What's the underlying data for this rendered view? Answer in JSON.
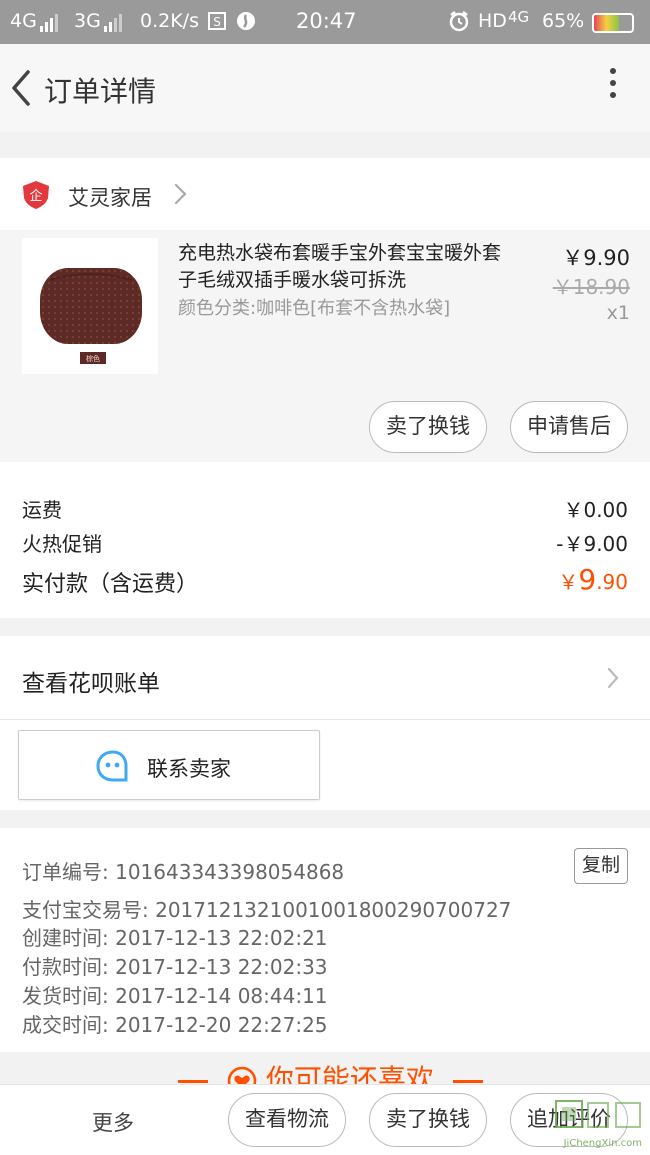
{
  "status_bar": {
    "net1": "4G",
    "net2": "3G",
    "speed": "0.2K/s",
    "time": "20:47",
    "hd": "HD",
    "net3": "4G",
    "battery": "65%",
    "battery_level": 0.65
  },
  "header": {
    "title": "订单详情"
  },
  "shop": {
    "name": "艾灵家居",
    "logo_glyph": "企"
  },
  "item": {
    "title": "充电热水袋布套暖手宝外套宝宝暖外套子毛绒双插手暖水袋可拆洗",
    "sku": "颜色分类:咖啡色[布套不含热水袋]",
    "price": "￥9.90",
    "original_price": "￥18.90",
    "quantity": "x1",
    "thumb_tag": "棕色",
    "buttons": [
      "卖了换钱",
      "申请售后"
    ]
  },
  "fees": {
    "shipping_label": "运费",
    "shipping_value": "￥0.00",
    "promo_label": "火热促销",
    "promo_value": "-￥9.00",
    "paid_label": "实付款（含运费）",
    "paid_currency": "￥",
    "paid_int": "9",
    "paid_dec": ".90"
  },
  "huabei": {
    "label": "查看花呗账单"
  },
  "contact": {
    "label": "联系卖家"
  },
  "order_info": {
    "copy_label": "复制",
    "rows": [
      {
        "label": "订单编号:",
        "value": "101643343398054868"
      },
      {
        "label": "支付宝交易号:",
        "value": "2017121321001001800290700727"
      },
      {
        "label": "创建时间:",
        "value": "2017-12-13 22:02:21"
      },
      {
        "label": "付款时间:",
        "value": "2017-12-13 22:02:33"
      },
      {
        "label": "发货时间:",
        "value": "2017-12-14 08:44:11"
      },
      {
        "label": "成交时间:",
        "value": "2017-12-20 22:27:25"
      }
    ]
  },
  "recommend": {
    "label": "你可能还喜欢"
  },
  "bottom_bar": {
    "more": "更多",
    "buttons": [
      "查看物流",
      "卖了换钱",
      "追加评价"
    ]
  },
  "watermark": {
    "text": "JiChengXin.com"
  },
  "colors": {
    "accent": "#ff5000",
    "shop_logo": "#e4393c",
    "contact_icon": "#3fa9f5"
  }
}
